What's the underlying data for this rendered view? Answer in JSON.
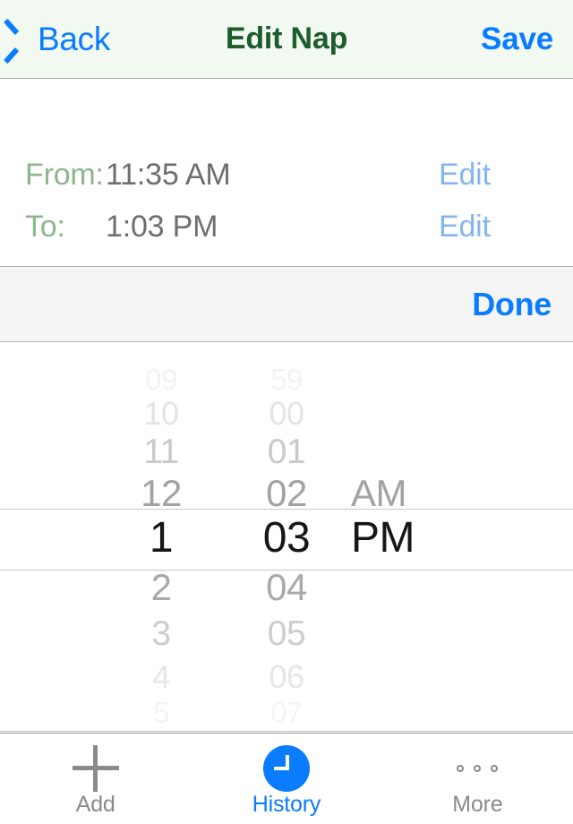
{
  "navbar": {
    "back_label": "Back",
    "title": "Edit Nap",
    "save_label": "Save",
    "background_color": "#f1f9f1",
    "tint_color": "#0a7cff",
    "title_color": "#1d5c2c"
  },
  "times": {
    "from_label": "From:",
    "from_value": "11:35 AM",
    "from_edit_label": "Edit",
    "to_label": "To:",
    "to_value": "1:03 PM",
    "to_edit_label": "Edit",
    "label_color": "#8cb78c",
    "value_color": "#6e6e6e",
    "edit_color": "#84b6ef"
  },
  "toolbar": {
    "done_label": "Done",
    "background_color": "#f5f5f5",
    "done_color": "#0a7cff"
  },
  "picker": {
    "selected_time": "1:03 PM",
    "hour": {
      "selected": "1",
      "above": [
        "09",
        "10",
        "11",
        "12"
      ],
      "below": [
        "2",
        "3",
        "4",
        "5"
      ]
    },
    "minute": {
      "selected": "03",
      "above": [
        "59",
        "00",
        "01",
        "02"
      ],
      "below": [
        "04",
        "05",
        "06",
        "07"
      ]
    },
    "period": {
      "selected": "PM",
      "above": [
        "",
        "",
        "",
        "AM"
      ],
      "below": [
        "",
        "",
        "",
        ""
      ]
    },
    "selected_text_color": "#161616"
  },
  "tabbar": {
    "tabs": [
      {
        "label": "Add",
        "icon": "plus-icon",
        "active": false
      },
      {
        "label": "History",
        "icon": "clock-icon",
        "active": true
      },
      {
        "label": "More",
        "icon": "ellipsis-icon",
        "active": false
      }
    ],
    "active_color": "#0a7cff",
    "inactive_color": "#8a8a8a"
  }
}
